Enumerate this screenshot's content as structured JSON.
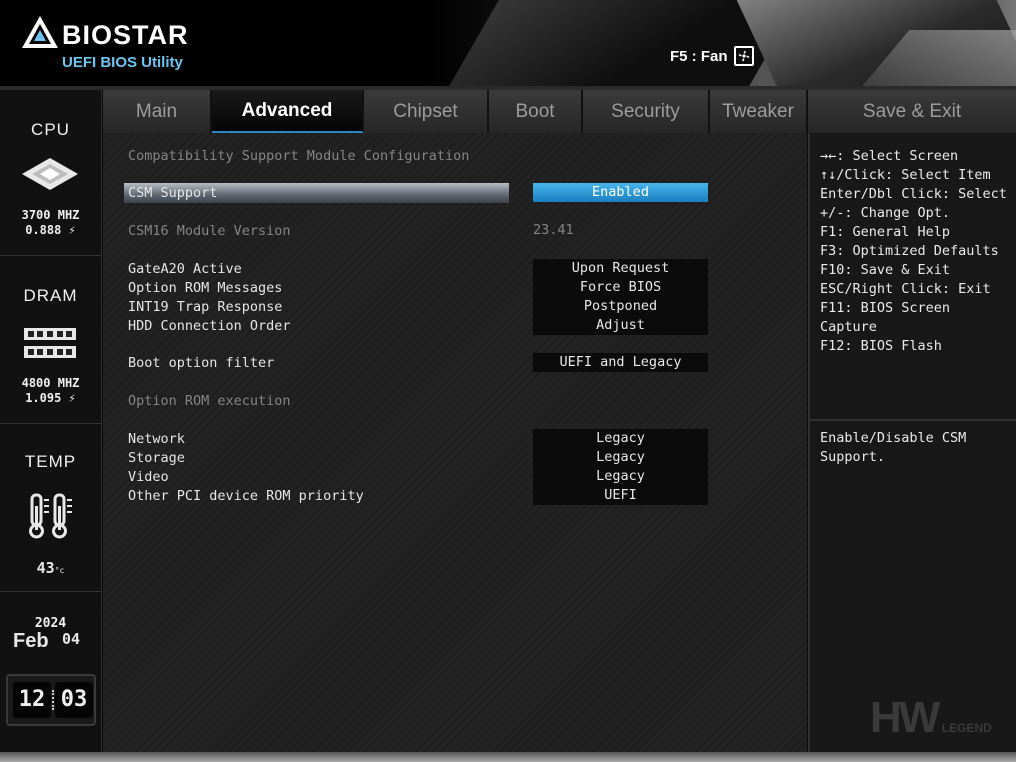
{
  "header": {
    "brand": "BIOSTAR",
    "subtitle": "UEFI BIOS Utility",
    "fan_label": "F5 : Fan"
  },
  "sidebar": {
    "cpu": {
      "title": "CPU",
      "freq": "3700 MHZ",
      "volt": "0.888 ⚡"
    },
    "dram": {
      "title": "DRAM",
      "freq": "4800 MHZ",
      "volt": "1.095 ⚡"
    },
    "temp": {
      "title": "TEMP",
      "value": "43",
      "unit": "°c"
    },
    "date": {
      "year": "2024",
      "month": "Feb",
      "day": "04"
    },
    "time": {
      "hour": "12",
      "minute": "03"
    }
  },
  "tabs": [
    {
      "label": "Main"
    },
    {
      "label": "Advanced"
    },
    {
      "label": "Chipset"
    },
    {
      "label": "Boot"
    },
    {
      "label": "Security"
    },
    {
      "label": "Tweaker"
    },
    {
      "label": "Save & Exit"
    }
  ],
  "main": {
    "section_title": "Compatibility Support Module Configuration",
    "csm_support": {
      "label": "CSM Support",
      "value": "Enabled"
    },
    "csm16": {
      "label": "CSM16 Module Version",
      "value": "23.41"
    },
    "gatea20": {
      "label": "GateA20 Active",
      "value": "Upon Request"
    },
    "option_rom_messages": {
      "label": "Option ROM Messages",
      "value": "Force BIOS"
    },
    "int19": {
      "label": "INT19 Trap Response",
      "value": "Postponed"
    },
    "hdd_order": {
      "label": "HDD Connection Order",
      "value": "Adjust"
    },
    "boot_filter": {
      "label": "Boot option filter",
      "value": "UEFI and Legacy"
    },
    "option_rom_exec": {
      "label": "Option ROM execution"
    },
    "network": {
      "label": "Network",
      "value": "Legacy"
    },
    "storage": {
      "label": "Storage",
      "value": "Legacy"
    },
    "video": {
      "label": "Video",
      "value": "Legacy"
    },
    "other_pci": {
      "label": "Other PCI device ROM priority",
      "value": "UEFI"
    }
  },
  "help": {
    "lines": [
      "→←: Select Screen",
      "↑↓/Click: Select Item",
      "Enter/Dbl Click: Select",
      "+/-: Change Opt.",
      "F1: General Help",
      "F3: Optimized Defaults",
      "F10: Save & Exit",
      "ESC/Right Click: Exit",
      "F11: BIOS Screen",
      "Capture",
      "F12: BIOS Flash"
    ],
    "description_line1": "Enable/Disable CSM",
    "description_line2": "Support."
  },
  "watermark": {
    "main": "HW",
    "sub": "LEGEND"
  },
  "colors": {
    "accent": "#2b8ac4",
    "selection": "#1b7fc0"
  }
}
